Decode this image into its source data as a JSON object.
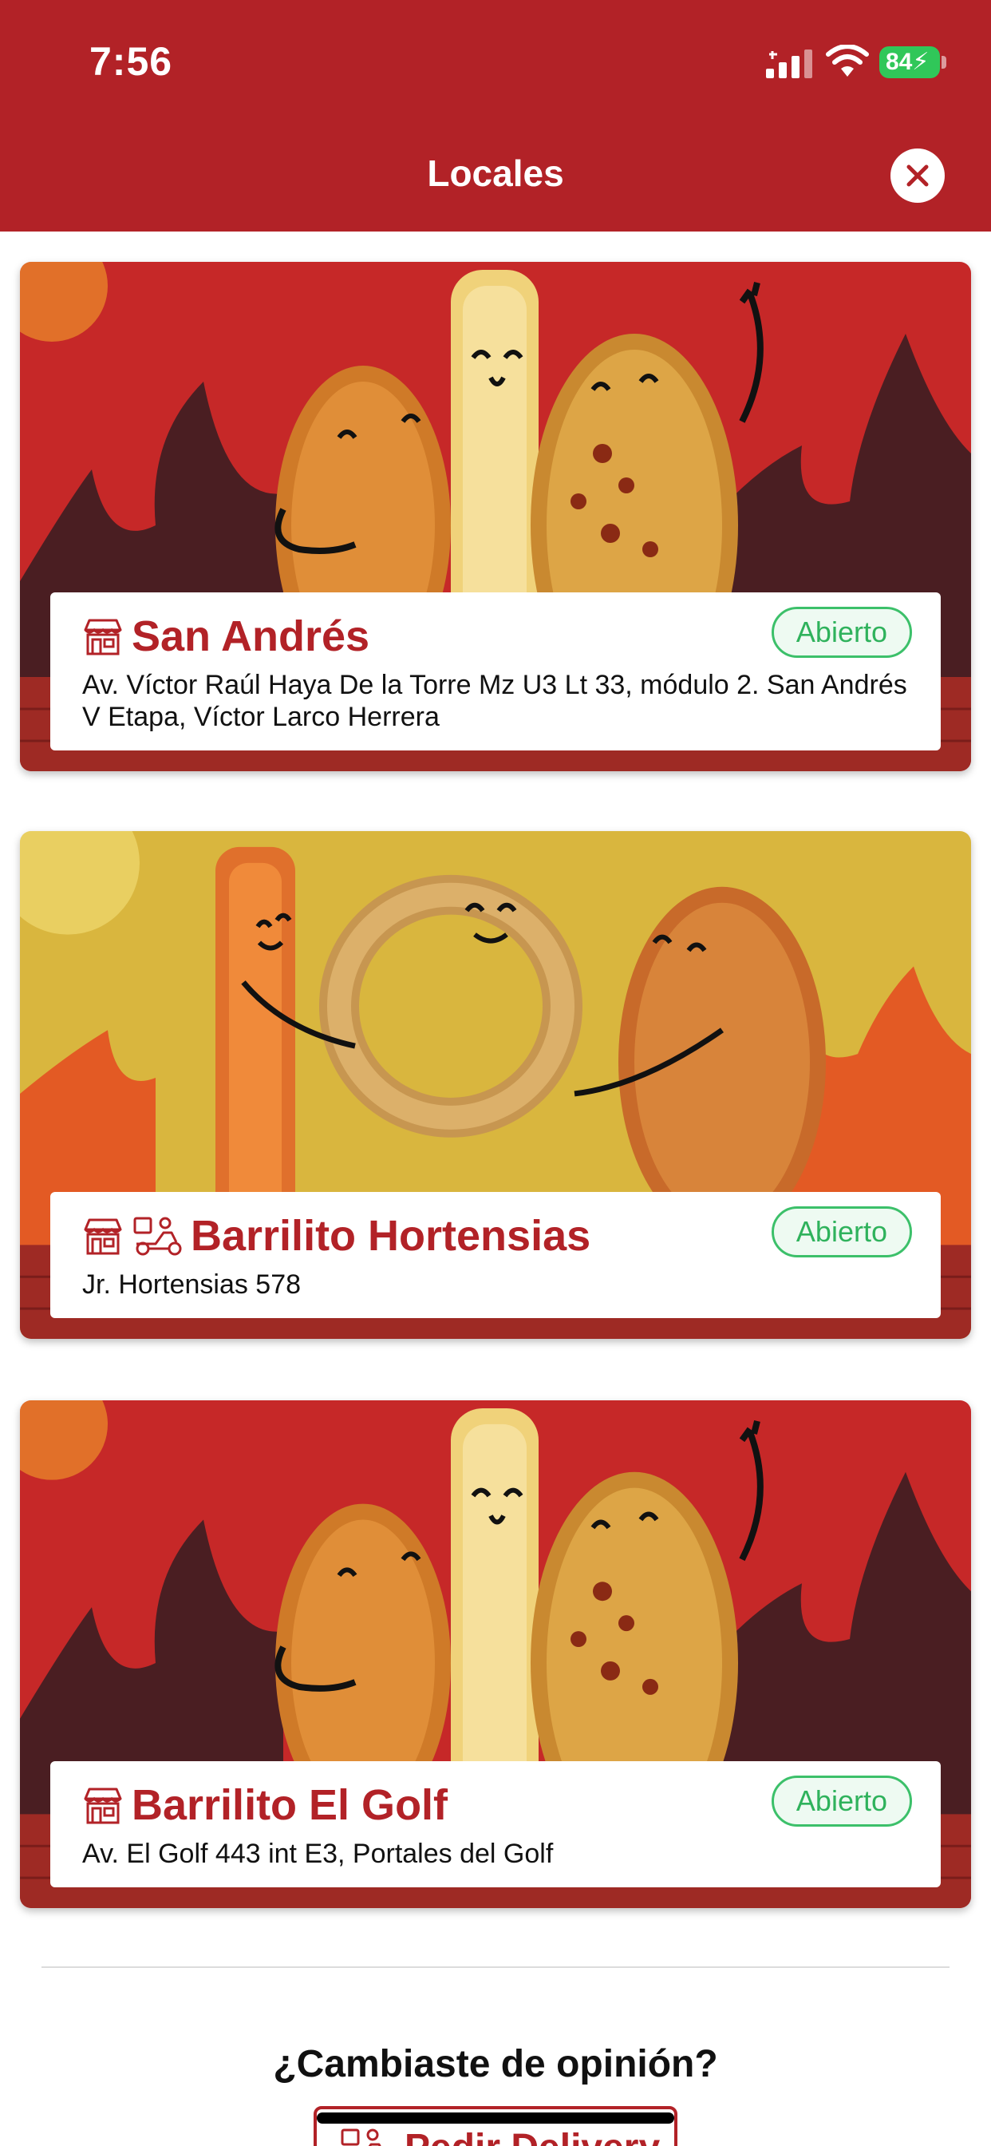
{
  "status_bar": {
    "time": "7:56",
    "battery": "84"
  },
  "header": {
    "title": "Locales"
  },
  "stores": [
    {
      "name": "San Andrés",
      "status": "Abierto",
      "address": "Av. Víctor Raúl Haya De la Torre Mz U3 Lt 33, módulo 2. San Andrés V Etapa, Víctor Larco Herrera",
      "delivery": false,
      "theme": "red"
    },
    {
      "name": "Barrilito Hortensias",
      "status": "Abierto",
      "address": "Jr. Hortensias 578",
      "delivery": true,
      "theme": "yellow"
    },
    {
      "name": "Barrilito El Golf",
      "status": "Abierto",
      "address": "Av. El Golf 443 int E3, Portales del Golf",
      "delivery": false,
      "theme": "red"
    }
  ],
  "footer": {
    "question": "¿Cambiaste de opinión?",
    "delivery_button": "Pedir Delivery"
  },
  "colors": {
    "brand": "#b22227",
    "open": "#3cc06a"
  },
  "icons": [
    "signal-icon",
    "wifi-icon",
    "battery-icon",
    "close-icon",
    "store-icon",
    "delivery-moto-icon"
  ]
}
